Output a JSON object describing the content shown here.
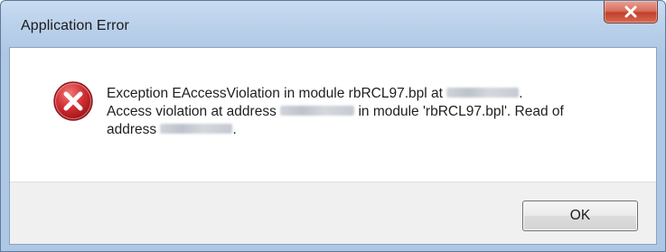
{
  "window": {
    "title": "Application Error",
    "close_label": "x"
  },
  "message": {
    "line1_prefix": "Exception EAccessViolation in module rbRCL97.bpl at",
    "line1_suffix": ".",
    "line2_prefix": "Access violation at address",
    "line2_suffix": "in module 'rbRCL97.bpl'. Read of",
    "line3_prefix": "address",
    "line3_suffix": "."
  },
  "icon": "error-x-icon",
  "buttons": {
    "ok_label": "OK"
  },
  "colors": {
    "title_bar": "#b9d0ea",
    "close_button": "#c2402d",
    "error_icon": "#c4262e",
    "footer": "#f0f0f0"
  }
}
